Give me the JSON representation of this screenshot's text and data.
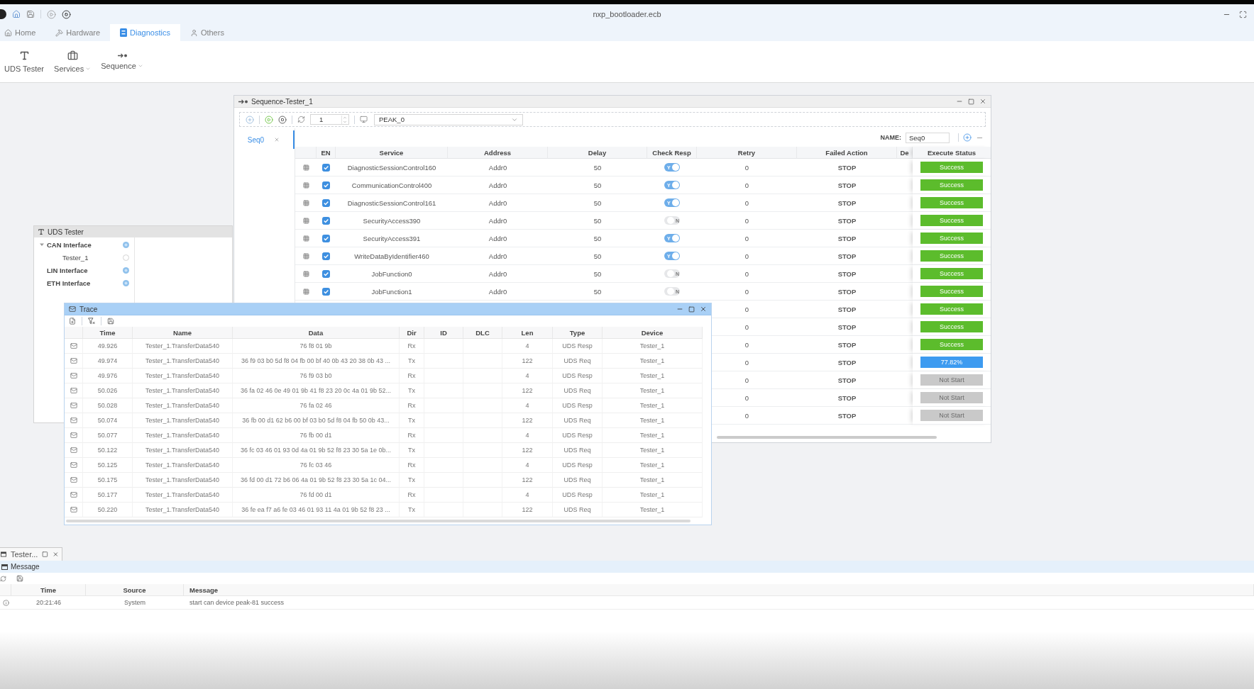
{
  "window": {
    "title": "nxp_bootloader.ecb"
  },
  "tabs": [
    {
      "label": "Home",
      "selected": false
    },
    {
      "label": "Hardware",
      "selected": false
    },
    {
      "label": "Diagnostics",
      "selected": true
    },
    {
      "label": "Others",
      "selected": false
    }
  ],
  "ribbon": [
    {
      "label": "UDS Tester",
      "dropdown": false
    },
    {
      "label": "Services",
      "dropdown": true
    },
    {
      "label": "Sequence",
      "dropdown": true
    }
  ],
  "sequence_tester": {
    "title": "Sequence-Tester_1",
    "repeat": "1",
    "device": "PEAK_0",
    "sequences": [
      {
        "label": "Seq0",
        "selected": true
      }
    ],
    "name_label": "NAME:",
    "name_value": "Seq0",
    "columns": [
      "EN",
      "Service",
      "Address",
      "Delay",
      "Check Resp",
      "Retry",
      "Failed Action",
      "De",
      "Execute Status"
    ],
    "rows": [
      {
        "en": true,
        "service": "DiagnosticSessionControl160",
        "address": "Addr0",
        "delay": "50",
        "check_resp": {
          "on": true,
          "label": "Y"
        },
        "retry": "0",
        "failed_action": "STOP",
        "status": {
          "kind": "success",
          "label": "Success"
        }
      },
      {
        "en": true,
        "service": "CommunicationControl400",
        "address": "Addr0",
        "delay": "50",
        "check_resp": {
          "on": true,
          "label": "Y"
        },
        "retry": "0",
        "failed_action": "STOP",
        "status": {
          "kind": "success",
          "label": "Success"
        }
      },
      {
        "en": true,
        "service": "DiagnosticSessionControl161",
        "address": "Addr0",
        "delay": "50",
        "check_resp": {
          "on": true,
          "label": "Y"
        },
        "retry": "0",
        "failed_action": "STOP",
        "status": {
          "kind": "success",
          "label": "Success"
        }
      },
      {
        "en": true,
        "service": "SecurityAccess390",
        "address": "Addr0",
        "delay": "50",
        "check_resp": {
          "on": false,
          "label": "N"
        },
        "retry": "0",
        "failed_action": "STOP",
        "status": {
          "kind": "success",
          "label": "Success"
        }
      },
      {
        "en": true,
        "service": "SecurityAccess391",
        "address": "Addr0",
        "delay": "50",
        "check_resp": {
          "on": true,
          "label": "Y"
        },
        "retry": "0",
        "failed_action": "STOP",
        "status": {
          "kind": "success",
          "label": "Success"
        }
      },
      {
        "en": true,
        "service": "WriteDataByIdentifier460",
        "address": "Addr0",
        "delay": "50",
        "check_resp": {
          "on": true,
          "label": "Y"
        },
        "retry": "0",
        "failed_action": "STOP",
        "status": {
          "kind": "success",
          "label": "Success"
        }
      },
      {
        "en": true,
        "service": "JobFunction0",
        "address": "Addr0",
        "delay": "50",
        "check_resp": {
          "on": false,
          "label": "N"
        },
        "retry": "0",
        "failed_action": "STOP",
        "status": {
          "kind": "success",
          "label": "Success"
        }
      },
      {
        "en": true,
        "service": "JobFunction1",
        "address": "Addr0",
        "delay": "50",
        "check_resp": {
          "on": false,
          "label": "N"
        },
        "retry": "0",
        "failed_action": "STOP",
        "status": {
          "kind": "success",
          "label": "Success"
        }
      },
      {
        "retry": "0",
        "failed_action": "STOP",
        "status": {
          "kind": "success",
          "label": "Success"
        }
      },
      {
        "retry": "0",
        "failed_action": "STOP",
        "status": {
          "kind": "success",
          "label": "Success"
        }
      },
      {
        "retry": "0",
        "failed_action": "STOP",
        "status": {
          "kind": "success",
          "label": "Success"
        }
      },
      {
        "retry": "0",
        "failed_action": "STOP",
        "status": {
          "kind": "running",
          "label": "77.82%"
        }
      },
      {
        "retry": "0",
        "failed_action": "STOP",
        "status": {
          "kind": "not_started",
          "label": "Not Start"
        }
      },
      {
        "retry": "0",
        "failed_action": "STOP",
        "status": {
          "kind": "not_started",
          "label": "Not Start"
        }
      },
      {
        "retry": "0",
        "failed_action": "STOP",
        "status": {
          "kind": "not_started",
          "label": "Not Start"
        }
      }
    ]
  },
  "uds_tester": {
    "title": "UDS Tester",
    "tree": [
      {
        "label": "CAN Interface",
        "expanded": true,
        "children": [
          {
            "label": "Tester_1"
          }
        ]
      },
      {
        "label": "LIN Interface"
      },
      {
        "label": "ETH Interface"
      }
    ]
  },
  "trace": {
    "title": "Trace",
    "columns": [
      "Time",
      "Name",
      "Data",
      "Dir",
      "ID",
      "DLC",
      "Len",
      "Type",
      "Device"
    ],
    "rows": [
      {
        "time": "49.926",
        "name": "Tester_1.TransferData540",
        "data": "76 f8 01 9b",
        "dir": "Rx",
        "len": "4",
        "type": "UDS Resp",
        "device": "Tester_1"
      },
      {
        "time": "49.974",
        "name": "Tester_1.TransferData540",
        "data": "36 f9 03 b0 5d f8 04 fb 00 bf 40 0b 43 20 38 0b 43 ...",
        "dir": "Tx",
        "len": "122",
        "type": "UDS Req",
        "device": "Tester_1"
      },
      {
        "time": "49.976",
        "name": "Tester_1.TransferData540",
        "data": "76 f9 03 b0",
        "dir": "Rx",
        "len": "4",
        "type": "UDS Resp",
        "device": "Tester_1"
      },
      {
        "time": "50.026",
        "name": "Tester_1.TransferData540",
        "data": "36 fa 02 46 0e 49 01 9b 41 f8 23 20 0c 4a 01 9b 52...",
        "dir": "Tx",
        "len": "122",
        "type": "UDS Req",
        "device": "Tester_1"
      },
      {
        "time": "50.028",
        "name": "Tester_1.TransferData540",
        "data": "76 fa 02 46",
        "dir": "Rx",
        "len": "4",
        "type": "UDS Resp",
        "device": "Tester_1"
      },
      {
        "time": "50.074",
        "name": "Tester_1.TransferData540",
        "data": "36 fb 00 d1 62 b6 00 bf 03 b0 5d f8 04 fb 50 0b 43...",
        "dir": "Tx",
        "len": "122",
        "type": "UDS Req",
        "device": "Tester_1"
      },
      {
        "time": "50.077",
        "name": "Tester_1.TransferData540",
        "data": "76 fb 00 d1",
        "dir": "Rx",
        "len": "4",
        "type": "UDS Resp",
        "device": "Tester_1"
      },
      {
        "time": "50.122",
        "name": "Tester_1.TransferData540",
        "data": "36 fc 03 46 01 93 0d 4a 01 9b 52 f8 23 30 5a 1e 0b...",
        "dir": "Tx",
        "len": "122",
        "type": "UDS Req",
        "device": "Tester_1"
      },
      {
        "time": "50.125",
        "name": "Tester_1.TransferData540",
        "data": "76 fc 03 46",
        "dir": "Rx",
        "len": "4",
        "type": "UDS Resp",
        "device": "Tester_1"
      },
      {
        "time": "50.175",
        "name": "Tester_1.TransferData540",
        "data": "36 fd 00 d1 72 b6 06 4a 01 9b 52 f8 23 30 5a 1c 04...",
        "dir": "Tx",
        "len": "122",
        "type": "UDS Req",
        "device": "Tester_1"
      },
      {
        "time": "50.177",
        "name": "Tester_1.TransferData540",
        "data": "76 fd 00 d1",
        "dir": "Rx",
        "len": "4",
        "type": "UDS Resp",
        "device": "Tester_1"
      },
      {
        "time": "50.220",
        "name": "Tester_1.TransferData540",
        "data": "36 fe ea f7 a6 fe 03 46 01 93 11 4a 01 9b 52 f8 23 ...",
        "dir": "Tx",
        "len": "122",
        "type": "UDS Req",
        "device": "Tester_1"
      }
    ]
  },
  "bottom_panel": {
    "tab": "Tester...",
    "title": "Message",
    "columns": [
      "Time",
      "Source",
      "Message"
    ],
    "rows": [
      {
        "time": "20:21:46",
        "source": "System",
        "message": "start can device peak-81 success"
      }
    ]
  }
}
